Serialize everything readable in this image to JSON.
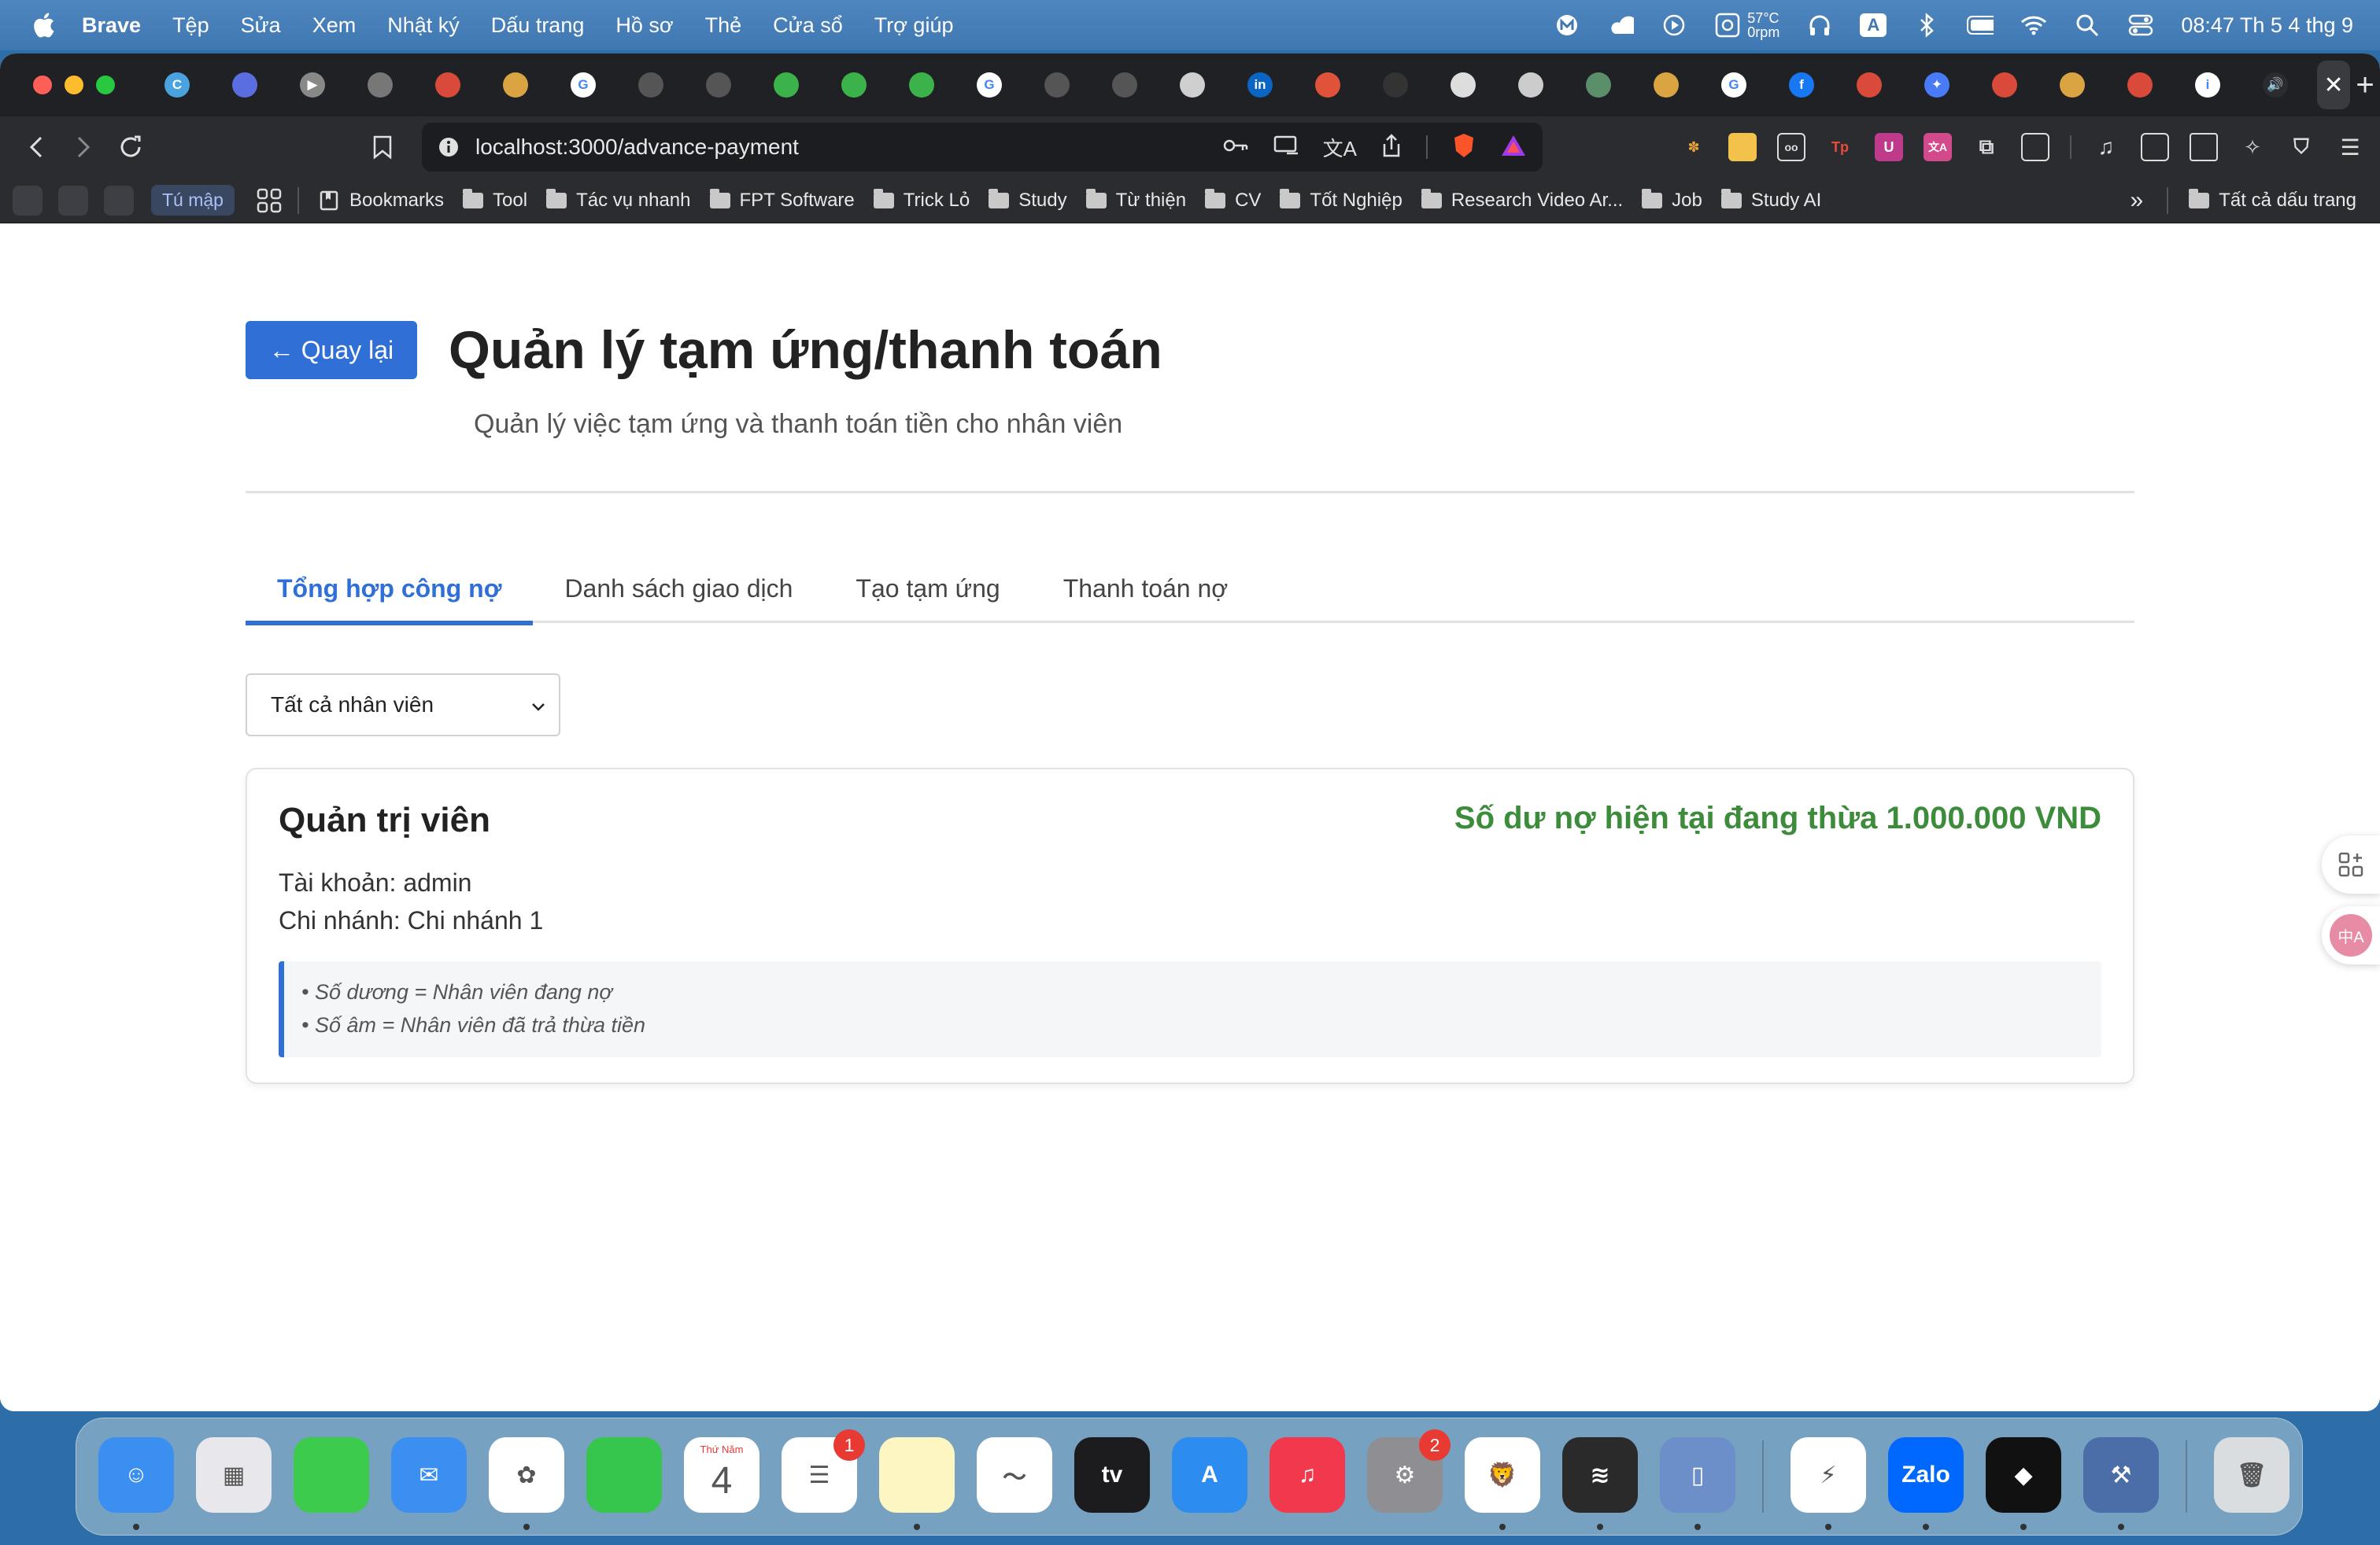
{
  "menubar": {
    "app_name": "Brave",
    "items": [
      "Tệp",
      "Sửa",
      "Xem",
      "Nhật ký",
      "Dấu trang",
      "Hồ sơ",
      "Thẻ",
      "Cửa sổ",
      "Trợ giúp"
    ],
    "temp": "57°C",
    "rpm": "0rpm",
    "input_source": "A",
    "clock": "08:47 Th 5 4 thg 9"
  },
  "browser": {
    "url": "localhost:3000/advance-payment",
    "close_tab_glyph": "✕",
    "new_tab_glyph": "+",
    "tab_favicons": [
      {
        "icon": "copilot-icon",
        "color": "#4aa3df",
        "glyph": "C"
      },
      {
        "icon": "app-icon",
        "color": "#5b6ee1",
        "glyph": ""
      },
      {
        "icon": "play-icon",
        "color": "#888888",
        "glyph": "▶"
      },
      {
        "icon": "app-icon",
        "color": "#777777",
        "glyph": ""
      },
      {
        "icon": "crown-icon",
        "color": "#d94a3a",
        "glyph": ""
      },
      {
        "icon": "avatar-icon",
        "color": "#d9a441",
        "glyph": ""
      },
      {
        "icon": "google-icon",
        "color": "#ffffff",
        "glyph": "G"
      },
      {
        "icon": "spinner-icon",
        "color": "#555555",
        "glyph": ""
      },
      {
        "icon": "spinner-icon",
        "color": "#555555",
        "glyph": ""
      },
      {
        "icon": "green-app-icon",
        "color": "#3cb34a",
        "glyph": ""
      },
      {
        "icon": "green-app-icon",
        "color": "#3cb34a",
        "glyph": ""
      },
      {
        "icon": "green-app-icon",
        "color": "#3cb34a",
        "glyph": ""
      },
      {
        "icon": "google-icon",
        "color": "#ffffff",
        "glyph": "G"
      },
      {
        "icon": "spinner-icon",
        "color": "#555555",
        "glyph": ""
      },
      {
        "icon": "spinner-icon",
        "color": "#555555",
        "glyph": ""
      },
      {
        "icon": "openai-icon",
        "color": "#cfcfcf",
        "glyph": ""
      },
      {
        "icon": "linkedin-icon",
        "color": "#0a66c2",
        "glyph": "in"
      },
      {
        "icon": "audio-icon",
        "color": "#e0533a",
        "glyph": ""
      },
      {
        "icon": "dot-icon",
        "color": "#333333",
        "glyph": ""
      },
      {
        "icon": "github-icon",
        "color": "#dddddd",
        "glyph": ""
      },
      {
        "icon": "crown-icon",
        "color": "#cccccc",
        "glyph": ""
      },
      {
        "icon": "spinner-icon",
        "color": "#5a8f6a",
        "glyph": ""
      },
      {
        "icon": "avatar-icon",
        "color": "#d9a441",
        "glyph": ""
      },
      {
        "icon": "google-icon",
        "color": "#ffffff",
        "glyph": "G"
      },
      {
        "icon": "facebook-icon",
        "color": "#1877f2",
        "glyph": "f"
      },
      {
        "icon": "mail-icon",
        "color": "#d94a3a",
        "glyph": ""
      },
      {
        "icon": "gemini-icon",
        "color": "#4a7bf7",
        "glyph": "✦"
      },
      {
        "icon": "mail-icon",
        "color": "#d94a3a",
        "glyph": ""
      },
      {
        "icon": "avatar-icon",
        "color": "#d9a441",
        "glyph": ""
      },
      {
        "icon": "mail-icon",
        "color": "#d94a3a",
        "glyph": ""
      },
      {
        "icon": "info-icon",
        "color": "#ffffff",
        "glyph": "i"
      },
      {
        "icon": "speaker-icon",
        "color": "#2b2c30",
        "glyph": "🔊"
      }
    ]
  },
  "bookmarks": {
    "tumap": "Tú mập",
    "items": [
      "Bookmarks",
      "Tool",
      "Tác vụ nhanh",
      "FPT Software",
      "Trick Lỏ",
      "Study",
      "Từ thiện",
      "CV",
      "Tốt Nghiệp",
      "Research Video Ar...",
      "Job",
      "Study AI"
    ],
    "more": "»",
    "all": "Tất cả dấu trang"
  },
  "page": {
    "back_label": "← Quay lại",
    "title": "Quản lý tạm ứng/thanh toán",
    "subtitle": "Quản lý việc tạm ứng và thanh toán tiền cho nhân viên",
    "tabs": [
      "Tổng hợp công nợ",
      "Danh sách giao dịch",
      "Tạo tạm ứng",
      "Thanh toán nợ"
    ],
    "active_tab": 0,
    "employee_filter": "Tất cả nhân viên",
    "card": {
      "name": "Quản trị viên",
      "balance": "Số dư nợ hiện tại đang thừa 1.000.000 VND",
      "account": "Tài khoản: admin",
      "branch": "Chi nhánh: Chi nhánh 1",
      "note_positive": "• Số dương = Nhân viên đang nợ",
      "note_negative": "• Số âm = Nhân viên đã trả thừa tiền"
    },
    "colors": {
      "accent": "#2f6fd6",
      "positive_green": "#3c8c3c"
    }
  },
  "dock": {
    "apps": [
      {
        "name": "Finder",
        "color": "#3b8ff0",
        "glyph": "☺",
        "dot": true
      },
      {
        "name": "Launchpad",
        "color": "#e8e8ec",
        "glyph": "▦"
      },
      {
        "name": "Messages",
        "color": "#3ccb4d",
        "glyph": ""
      },
      {
        "name": "Mail",
        "color": "#3b8ff0",
        "glyph": "✉"
      },
      {
        "name": "Photos",
        "color": "#ffffff",
        "glyph": "✿",
        "dot": true
      },
      {
        "name": "FaceTime",
        "color": "#36c64d",
        "glyph": ""
      },
      {
        "name": "Calendar",
        "color": "#ffffff",
        "glyph": "4",
        "label": "Thứ Năm"
      },
      {
        "name": "Reminders",
        "color": "#ffffff",
        "glyph": "☰",
        "badge": "1"
      },
      {
        "name": "Notes",
        "color": "#fdf6c3",
        "glyph": "",
        "dot": true
      },
      {
        "name": "Freeform",
        "color": "#ffffff",
        "glyph": "〜"
      },
      {
        "name": "Apple TV",
        "color": "#1c1c1e",
        "glyph": "tv"
      },
      {
        "name": "App Store",
        "color": "#2d8cf0",
        "glyph": "A"
      },
      {
        "name": "Music",
        "color": "#f2384c",
        "glyph": "♫"
      },
      {
        "name": "System Settings",
        "color": "#8e8e93",
        "glyph": "⚙",
        "badge": "2"
      },
      {
        "name": "Brave",
        "color": "#ffffff",
        "glyph": "🦁",
        "dot": true
      },
      {
        "name": "Spotify",
        "color": "#2a2a2a",
        "glyph": "≋",
        "dot": true
      },
      {
        "name": "Simulator",
        "color": "#6c8ec9",
        "glyph": "▯",
        "dot": true
      },
      {
        "name": "Messenger",
        "color": "#ffffff",
        "glyph": "⚡",
        "dot": true
      },
      {
        "name": "Zalo",
        "color": "#0068ff",
        "glyph": "Zalo",
        "dot": true
      },
      {
        "name": "Cursor",
        "color": "#111111",
        "glyph": "◆",
        "dot": true
      },
      {
        "name": "Xcode",
        "color": "#4b6ea8",
        "glyph": "⚒",
        "dot": true
      },
      {
        "name": "Trash",
        "color": "#d9dde0",
        "glyph": "🗑"
      }
    ]
  }
}
